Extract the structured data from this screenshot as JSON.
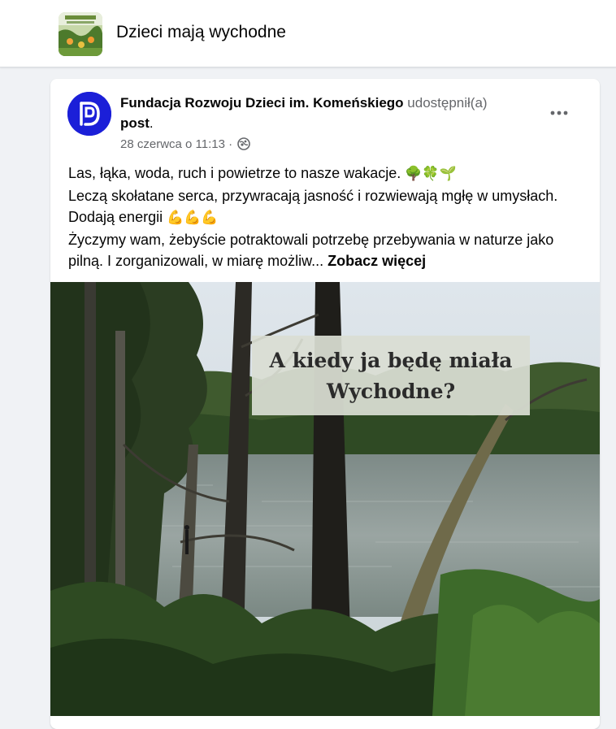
{
  "header": {
    "group_title": "Dzieci mają wychodne",
    "thumbnail_icon": "group-thumbnail-forest"
  },
  "post": {
    "author": "Fundacja Rozwoju Dzieci im. Komeńskiego",
    "shared_text": "udostępnił(a)",
    "post_link": "post",
    "post_link_suffix": ".",
    "timestamp": "28 czerwca o 11:13",
    "separator": "·",
    "audience_icon": "globe-icon",
    "more_icon": "more-options-icon",
    "text_line1": "Las, łąka, woda, ruch i powietrze to nasze wakacje.",
    "text_line1_emoji": "🌳🍀🌱",
    "text_line2": "Leczą skołatane serca, przywracają jasność i rozwiewają mgłę w umysłach. Dodają energii",
    "text_line2_emoji": "💪💪💪",
    "text_line3": "Życzymy wam, żebyście potraktowali potrzebę przebywania w naturze jako pilną. I zorganizowali, w miarę możliw...",
    "see_more": "Zobacz więcej",
    "image": {
      "overlay_line1": "A kiedy ja będę miała",
      "overlay_line2": "Wychodne?"
    }
  },
  "colors": {
    "avatar_bg": "#1b1fd8",
    "text_primary": "#050505",
    "text_secondary": "#65676b",
    "page_bg": "#f0f2f5"
  }
}
